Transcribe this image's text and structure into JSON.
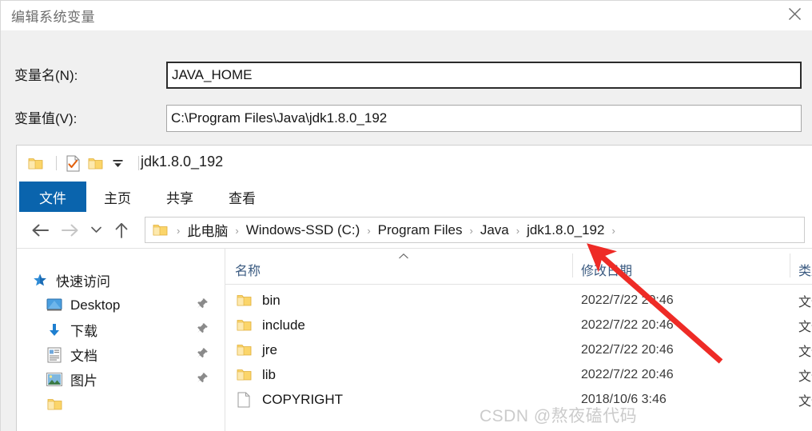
{
  "dialog": {
    "title": "编辑系统变量",
    "close_icon": "close-icon",
    "fields": [
      {
        "label": "变量名(N):",
        "value": "JAVA_HOME",
        "placeholder": "",
        "focused": true
      },
      {
        "label": "变量值(V):",
        "value": "C:\\Program Files\\Java\\jdk1.8.0_192",
        "placeholder": "",
        "focused": false
      }
    ]
  },
  "explorer": {
    "title": "jdk1.8.0_192",
    "quick_access_toolbar": [
      {
        "icon": "folder-icon",
        "name": "system-menu-folder-icon"
      },
      {
        "icon": "properties-icon",
        "name": "properties-icon"
      },
      {
        "icon": "new-folder-icon",
        "name": "new-folder-icon"
      },
      {
        "icon": "chevron-down-icon",
        "name": "customize-qat-chevron-icon"
      }
    ],
    "ribbon_tabs": [
      {
        "label": "文件",
        "active": true
      },
      {
        "label": "主页",
        "active": false
      },
      {
        "label": "共享",
        "active": false
      },
      {
        "label": "查看",
        "active": false
      }
    ],
    "nav_buttons": [
      {
        "name": "back-button",
        "icon": "arrow-left-icon",
        "enabled": true
      },
      {
        "name": "forward-button",
        "icon": "arrow-right-icon",
        "enabled": false
      },
      {
        "name": "recent-locations-button",
        "icon": "chevron-down-icon",
        "enabled": true
      },
      {
        "name": "up-button",
        "icon": "arrow-up-icon",
        "enabled": true
      }
    ],
    "breadcrumb": {
      "leading_icon": "folder-icon",
      "separator": "›",
      "items": [
        "此电脑",
        "Windows-SSD (C:)",
        "Program Files",
        "Java",
        "jdk1.8.0_192"
      ],
      "trailing_separator": "›"
    },
    "nav_pane": {
      "root": {
        "label": "快速访问",
        "icon": "star-pin-icon"
      },
      "items": [
        {
          "label": "Desktop",
          "icon": "desktop-icon",
          "pinned": true
        },
        {
          "label": "下载",
          "icon": "downloads-icon",
          "pinned": true
        },
        {
          "label": "文档",
          "icon": "documents-icon",
          "pinned": true
        },
        {
          "label": "图片",
          "icon": "pictures-icon",
          "pinned": true
        }
      ]
    },
    "file_list": {
      "columns": [
        {
          "label": "名称",
          "sorted": true,
          "sort_direction": "asc"
        },
        {
          "label": "修改日期",
          "sorted": false
        },
        {
          "label": "类型",
          "sorted": false
        }
      ],
      "rows": [
        {
          "name": "bin",
          "icon": "folder-icon",
          "date": "2022/7/22 20:46",
          "type": "文件夹"
        },
        {
          "name": "include",
          "icon": "folder-icon",
          "date": "2022/7/22 20:46",
          "type": "文件夹"
        },
        {
          "name": "jre",
          "icon": "folder-icon",
          "date": "2022/7/22 20:46",
          "type": "文件夹"
        },
        {
          "name": "lib",
          "icon": "folder-icon",
          "date": "2022/7/22 20:46",
          "type": "文件夹"
        },
        {
          "name": "COPYRIGHT",
          "icon": "file-icon",
          "date": "2018/10/6 3:46",
          "type": "文件"
        }
      ]
    }
  },
  "annotation": {
    "arrow_color": "#ee2b26",
    "arrow_name": "red-callout-arrow"
  },
  "watermark": {
    "text": "CSDN @熬夜磕代码"
  },
  "colors": {
    "ribbon_file_tab": "#0a64ad",
    "dialog_background": "#f0f0f0",
    "column_header_text": "#3a5a80",
    "accent_blue": "#0a64ad"
  }
}
